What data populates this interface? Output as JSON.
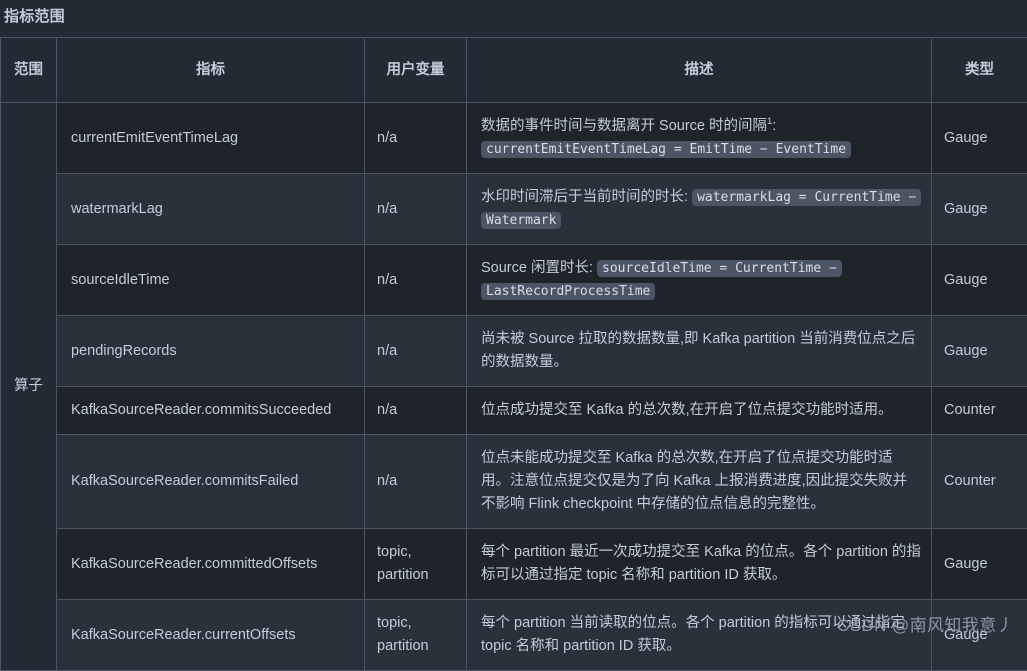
{
  "page": {
    "title": "指标范围",
    "watermark": "CSDN @南风知我意丿"
  },
  "table": {
    "headers": {
      "scope": "范围",
      "metric": "指标",
      "user_variables": "用户变量",
      "description": "描述",
      "type": "类型"
    },
    "scope_value": "算子",
    "rows": [
      {
        "metric": "currentEmitEventTimeLag",
        "user_variables": "n/a",
        "desc_text": "数据的事件时间与数据离开 Source 时的间隔",
        "desc_sup": "1",
        "desc_tail": ":",
        "desc_code": "currentEmitEventTimeLag = EmitTime − EventTime",
        "desc_after": "",
        "type": "Gauge"
      },
      {
        "metric": "watermarkLag",
        "user_variables": "n/a",
        "desc_text": "水印时间滞后于当前时间的时长:",
        "desc_sup": "",
        "desc_tail": "",
        "desc_code": "watermarkLag = CurrentTime − Watermark",
        "desc_after": "",
        "type": "Gauge"
      },
      {
        "metric": "sourceIdleTime",
        "user_variables": "n/a",
        "desc_text": "Source 闲置时长:",
        "desc_sup": "",
        "desc_tail": "",
        "desc_code": "sourceIdleTime = CurrentTime − LastRecordProcessTime",
        "desc_after": "",
        "type": "Gauge"
      },
      {
        "metric": "pendingRecords",
        "user_variables": "n/a",
        "desc_text": "尚未被 Source 拉取的数据数量,即 Kafka partition 当前消费位点之后的数据数量。",
        "desc_sup": "",
        "desc_tail": "",
        "desc_code": "",
        "desc_after": "",
        "type": "Gauge"
      },
      {
        "metric": "KafkaSourceReader.commitsSucceeded",
        "user_variables": "n/a",
        "desc_text": "位点成功提交至 Kafka 的总次数,在开启了位点提交功能时适用。",
        "desc_sup": "",
        "desc_tail": "",
        "desc_code": "",
        "desc_after": "",
        "type": "Counter"
      },
      {
        "metric": "KafkaSourceReader.commitsFailed",
        "user_variables": "n/a",
        "desc_text": "位点未能成功提交至 Kafka 的总次数,在开启了位点提交功能时适用。注意位点提交仅是为了向 Kafka 上报消费进度,因此提交失败并不影响 Flink checkpoint 中存储的位点信息的完整性。",
        "desc_sup": "",
        "desc_tail": "",
        "desc_code": "",
        "desc_after": "",
        "type": "Counter"
      },
      {
        "metric": "KafkaSourceReader.committedOffsets",
        "user_variables": "topic, partition",
        "desc_text": "每个 partition 最近一次成功提交至 Kafka 的位点。各个 partition 的指标可以通过指定 topic 名称和 partition ID 获取。",
        "desc_sup": "",
        "desc_tail": "",
        "desc_code": "",
        "desc_after": "",
        "type": "Gauge"
      },
      {
        "metric": "KafkaSourceReader.currentOffsets",
        "user_variables": "topic, partition",
        "desc_text": "每个 partition 当前读取的位点。各个 partition 的指标可以通过指定 topic 名称和 partition ID 获取。",
        "desc_sup": "",
        "desc_tail": "",
        "desc_code": "",
        "desc_after": "",
        "type": "Gauge"
      }
    ]
  }
}
